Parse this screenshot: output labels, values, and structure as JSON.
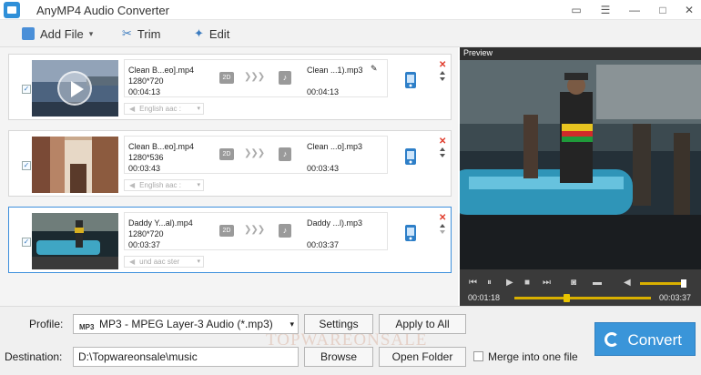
{
  "window": {
    "title": "AnyMP4 Audio Converter"
  },
  "title_controls": [
    "feedback-icon",
    "menu-icon",
    "minimize-icon",
    "maximize-icon",
    "close-icon"
  ],
  "toolbar": {
    "add_file": "Add File",
    "trim": "Trim",
    "edit": "Edit"
  },
  "files": [
    {
      "src_name": "Clean B...eo].mp4",
      "src_res": "1280*720",
      "src_dur": "00:04:13",
      "dst_name": "Clean ...1).mp3",
      "dst_dur": "00:04:13",
      "badge": "2D",
      "arrows": "❯❯❯",
      "audio_track": "English aac :",
      "selected": false
    },
    {
      "src_name": "Clean B...eo].mp4",
      "src_res": "1280*536",
      "src_dur": "00:03:43",
      "dst_name": "Clean ...o].mp3",
      "dst_dur": "00:03:43",
      "badge": "2D",
      "arrows": "❯❯❯",
      "audio_track": "English aac :",
      "selected": false
    },
    {
      "src_name": "Daddy Y...al).mp4",
      "src_res": "1280*720",
      "src_dur": "00:03:37",
      "dst_name": "Daddy ...l).mp3",
      "dst_dur": "00:03:37",
      "badge": "2D",
      "arrows": "❯❯❯",
      "audio_track": "und aac ster",
      "selected": true
    }
  ],
  "preview": {
    "label": "Preview",
    "current_time": "00:01:18",
    "total_time": "00:03:37",
    "seek_fraction": 0.36,
    "volume_fraction": 0.95
  },
  "bottom": {
    "profile_label": "Profile:",
    "profile_value": "MP3 - MPEG Layer-3 Audio (*.mp3)",
    "profile_icon_text": "MP3",
    "settings": "Settings",
    "apply_all": "Apply to All",
    "destination_label": "Destination:",
    "destination_value": "D:\\Topwareonsale\\music",
    "browse": "Browse",
    "open_folder": "Open Folder",
    "merge": "Merge into one file",
    "convert": "Convert",
    "watermark": "TOPWAREONSALE"
  },
  "colors": {
    "accent": "#3a95d9",
    "seek": "#d9b000",
    "delete": "#e03a2a"
  }
}
